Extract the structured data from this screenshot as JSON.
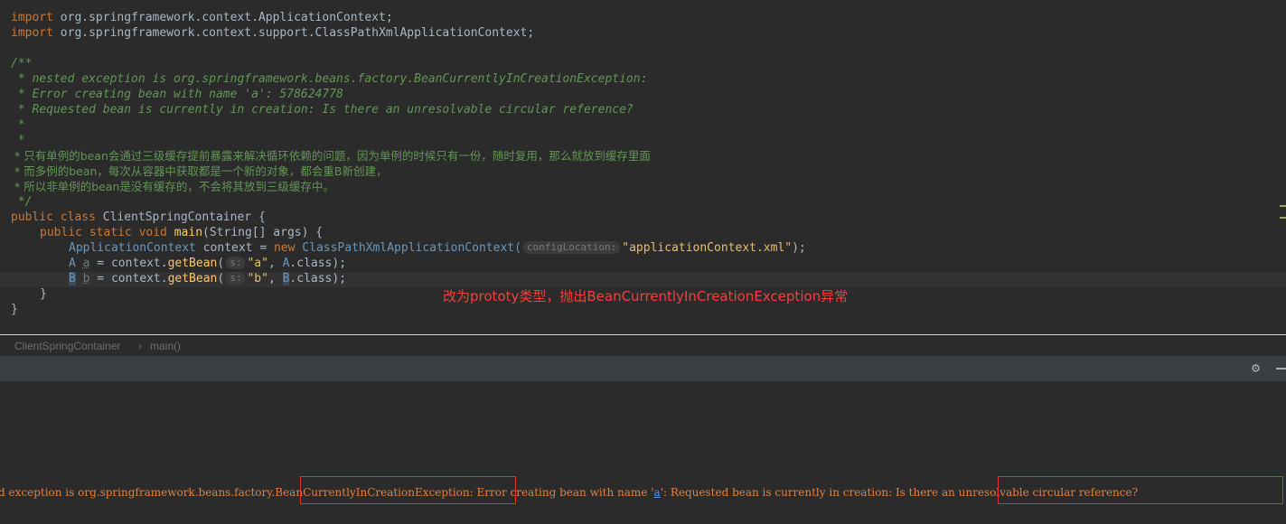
{
  "editor": {
    "imports": [
      {
        "kw": "import",
        "path": "org.springframework.context.ApplicationContext;"
      },
      {
        "kw": "import",
        "path": "org.springframework.context.support.ClassPathXmlApplicationContext;"
      }
    ],
    "comment_lines": [
      "/**",
      " * nested exception is org.springframework.beans.factory.BeanCurrentlyInCreationException:",
      " * Error creating bean with name 'a': 578624778",
      " * Requested bean is currently in creation: Is there an unresolvable circular reference?",
      " *",
      " *",
      " * 只有单例的bean会通过三级缓存提前暴露来解决循环依赖的问题，因为单例的时候只有一份，随时复用，那么就放到缓存里面",
      " * 而多例的bean，每次从容器中获取都是一个新的对象，都会重B新创建，",
      " * 所以非单例的bean是没有缓存的，不会将其放到三级缓存中。",
      " */"
    ],
    "class_decl": {
      "kw": "public class",
      "name": "ClientSpringContainer",
      "brace": " {"
    },
    "main_decl": {
      "kw": "public static void",
      "name": "main",
      "params": "(String[] args) {"
    },
    "stmt1": {
      "type": "ApplicationContext",
      "rest1": " context = ",
      "kw_new": "new",
      "ctor": " ClassPathXmlApplicationContext(",
      "hint": "configLocation:",
      "arg": "\"applicationContext.xml\"",
      "end": ");"
    },
    "stmt2": {
      "type": "A",
      "var": "a",
      "mid": " = context.",
      "fn": "getBean",
      "open": "(",
      "hint": "s:",
      "arg": "\"a\"",
      "sep": ", ",
      "cls": "A",
      "end": ".class);"
    },
    "stmt3": {
      "type": "B",
      "var": "b",
      "mid": " = context.",
      "fn": "getBean",
      "open": "(",
      "hint": "s:",
      "arg": "\"b\"",
      "sep": ", ",
      "cls": "B",
      "end": ".class);"
    },
    "close_main": "}",
    "close_class": "}"
  },
  "annotation": "改为prototy类型，抛出BeanCurrentlyInCreationException异常",
  "breadcrumb": {
    "items": [
      "ClientSpringContainer",
      "main()"
    ],
    "sep": "›"
  },
  "console": {
    "seg1": "d exception is org.springframework.beans.factory.",
    "seg2": "BeanCurrentlyInCreationException:",
    "seg3": " Error creating bean with name '",
    "link": "a",
    "seg4": "': Requested bean is currently in creation: ",
    "seg5": "Is there an unresolvable circular reference?"
  },
  "icons": {
    "settings": "gear-icon",
    "hide": "minimize-icon"
  },
  "colors": {
    "background": "#2b2b2b",
    "keyword": "#cc7832",
    "comment": "#629755",
    "error_text": "#e2813e",
    "annotation": "#ff3b3b"
  }
}
